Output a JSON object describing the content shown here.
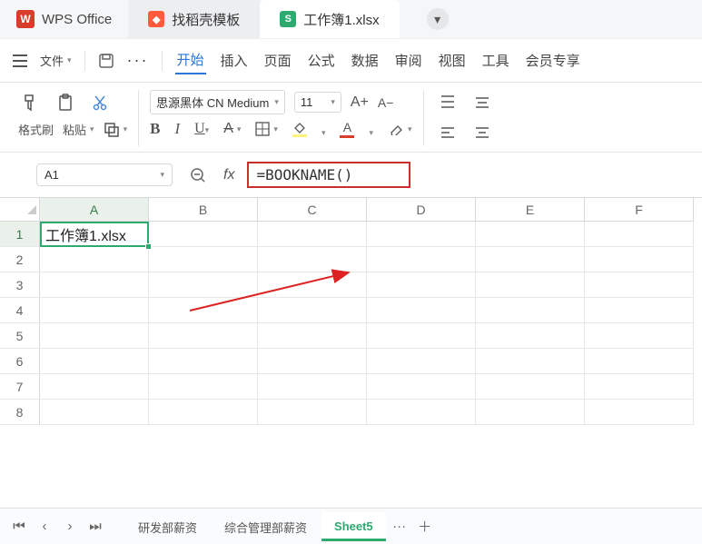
{
  "app": {
    "name": "WPS Office"
  },
  "titleTabs": {
    "templates": "找稻壳模板",
    "file": "工作簿1.xlsx"
  },
  "menu": {
    "fileBtn": "文件",
    "tabs": [
      "开始",
      "插入",
      "页面",
      "公式",
      "数据",
      "审阅",
      "视图",
      "工具",
      "会员专享"
    ],
    "active": 0
  },
  "toolbar": {
    "formatBrush": "格式刷",
    "paste": "粘贴",
    "font": "思源黑体 CN Medium",
    "fontSize": "11",
    "aPlus": "A+",
    "aMinus": "A−",
    "bold": "B",
    "italic": "I",
    "underline": "U",
    "strike": "A",
    "fillColor": "#fff17a",
    "fontColor": "#d83c2a"
  },
  "nameBox": "A1",
  "fx": "fx",
  "formula": "=BOOKNAME()",
  "columns": [
    "A",
    "B",
    "C",
    "D",
    "E",
    "F"
  ],
  "rows": [
    1,
    2,
    3,
    4,
    5,
    6,
    7,
    8
  ],
  "cells": {
    "A1": "工作簿1.xlsx"
  },
  "sheets": {
    "list": [
      "研发部薪资",
      "综合管理部薪资",
      "Sheet5"
    ],
    "active": 2
  }
}
